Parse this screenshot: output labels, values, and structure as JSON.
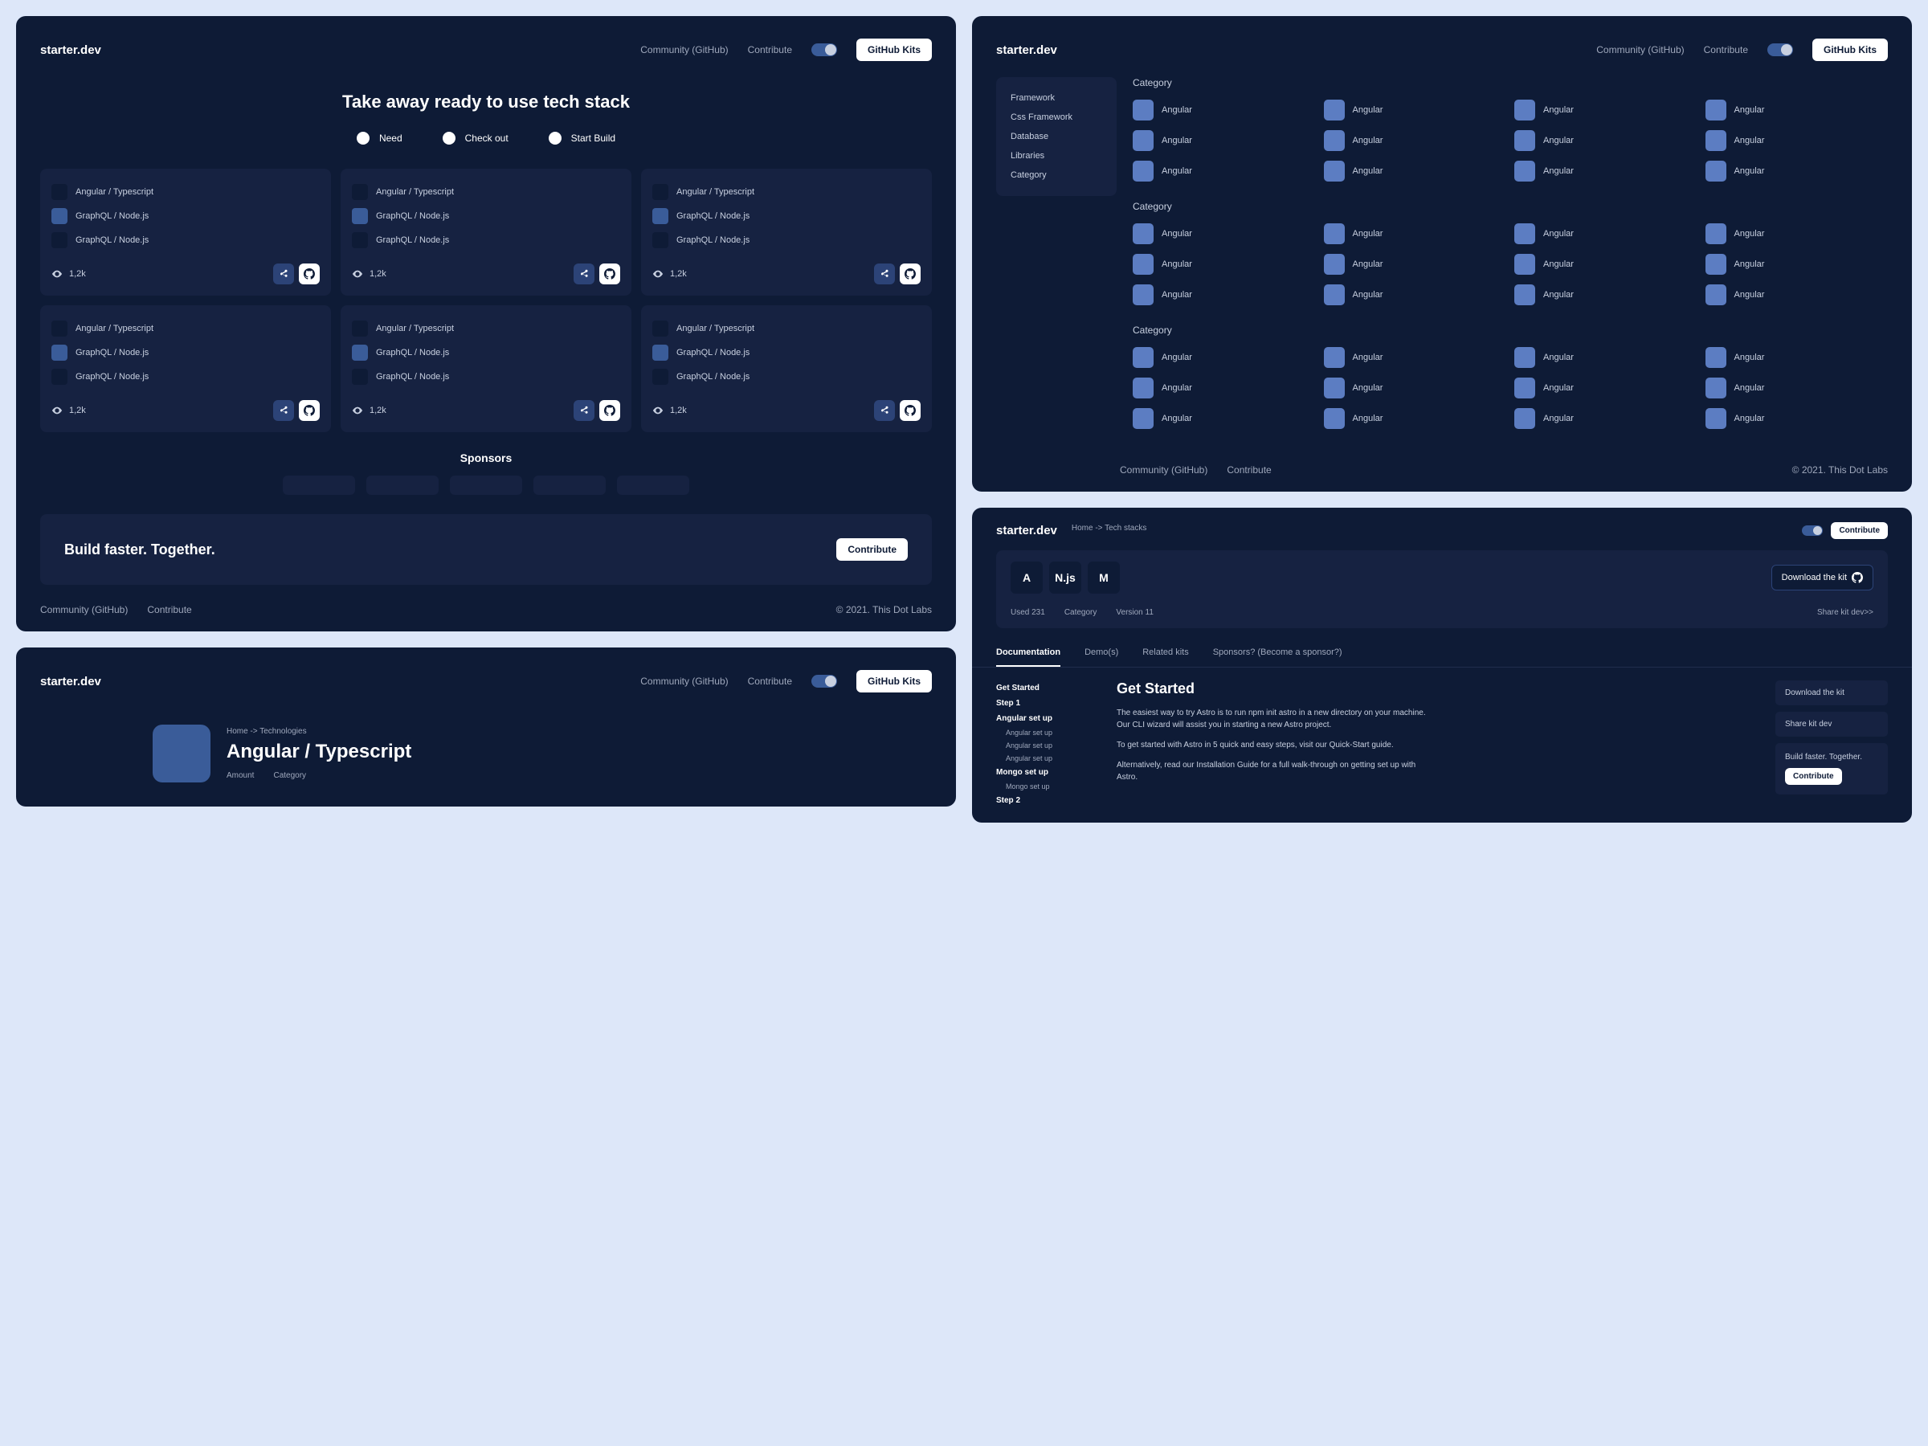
{
  "brand": "starter.dev",
  "nav": {
    "community": "Community (GitHub)",
    "contribute": "Contribute",
    "kits_btn": "GitHub Kits"
  },
  "hero": {
    "title": "Take away ready to use tech stack",
    "steps": [
      "Need",
      "Check out",
      "Start Build"
    ]
  },
  "card_techs": [
    "Angular / Typescript",
    "GraphQL / Node.js",
    "GraphQL / Node.js"
  ],
  "card_views": "1,2k",
  "sponsors_title": "Sponsors",
  "cta": {
    "title": "Build faster. Together.",
    "btn": "Contribute"
  },
  "footer": {
    "community": "Community (GitHub)",
    "contribute": "Contribute",
    "copy": "© 2021. This Dot Labs"
  },
  "sidebar": [
    "Framework",
    "Css Framework",
    "Database",
    "Libraries",
    "Category"
  ],
  "cat_label": "Category",
  "cat_item": "Angular",
  "detail": {
    "breadcrumb": "Home -> Technologies",
    "title": "Angular / Typescript",
    "meta": [
      "Amount",
      "Category"
    ]
  },
  "p4": {
    "breadcrumb": "Home -> Tech stacks",
    "contribute": "Contribute",
    "tiles": [
      "A",
      "N.js",
      "M"
    ],
    "download": "Download the kit",
    "meta": [
      "Used 231",
      "Category",
      "Version 11"
    ],
    "share": "Share kit dev>>",
    "tabs": [
      "Documentation",
      "Demo(s)",
      "Related kits",
      "Sponsors? (Become a sponsor?)"
    ],
    "nav": {
      "get_started": "Get Started",
      "step1": "Step 1",
      "angular_setup": "Angular set up",
      "angular_sub": "Angular set up",
      "mongo_setup": "Mongo set up",
      "mongo_sub": "Mongo set up",
      "step2": "Step 2"
    },
    "docs": {
      "title": "Get Started",
      "p1": "The easiest way to try Astro is to run npm init astro in a new directory on your machine. Our CLI wizard will assist you in starting a new Astro project.",
      "p2": "To get started with Astro in 5 quick and easy steps, visit our Quick-Start guide.",
      "p3": "Alternatively, read our Installation Guide for a full walk-through on getting set up with Astro."
    },
    "side": {
      "download": "Download the kit",
      "share": "Share kit dev",
      "cta_text": "Build faster. Together.",
      "cta_btn": "Contribute"
    }
  }
}
